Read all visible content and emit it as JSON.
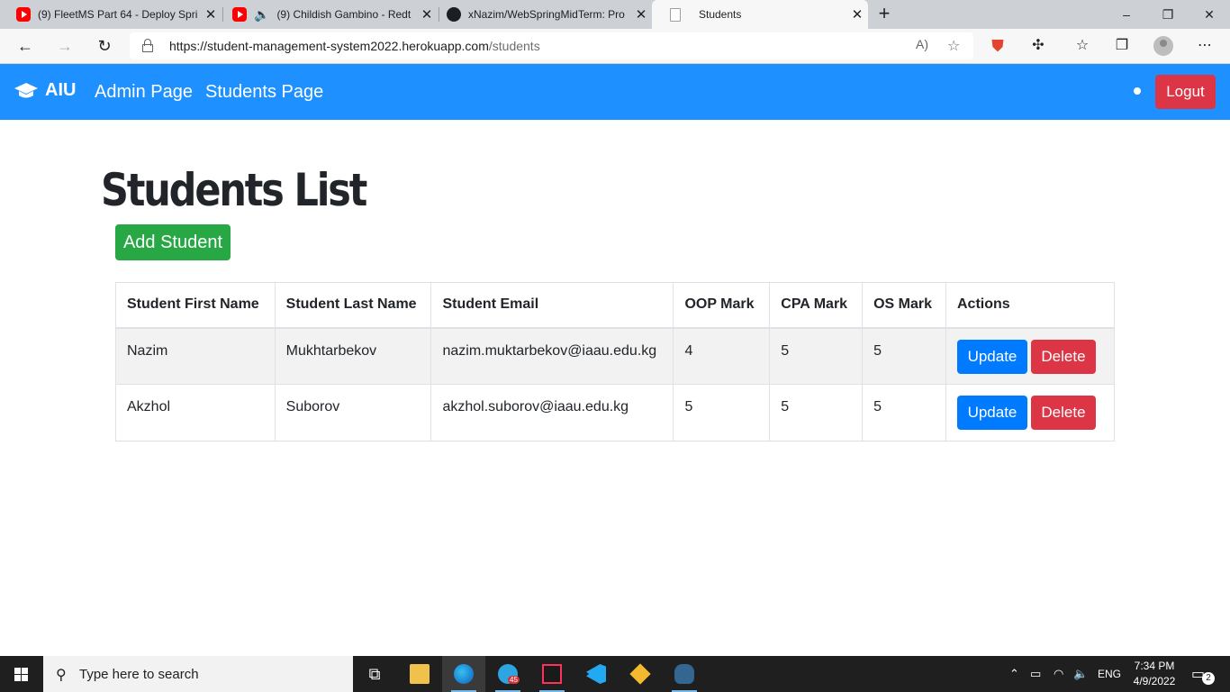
{
  "browser": {
    "tabs": [
      {
        "title": "(9) FleetMS Part 64 - Deploy Spri",
        "icon": "youtube-icon"
      },
      {
        "title": "(9) Childish Gambino - Redt",
        "icon": "youtube-icon",
        "audio": "speaker-icon"
      },
      {
        "title": "xNazim/WebSpringMidTerm: Pro",
        "icon": "github-icon"
      },
      {
        "title": "Students",
        "icon": "page-icon",
        "active": true
      }
    ],
    "new_tab_label": "+",
    "window_controls": [
      "–",
      "❐",
      "✕"
    ],
    "address": {
      "host": "https://student-management-system2022.herokuapp.com",
      "path": "/students"
    }
  },
  "navbar": {
    "brand": "AIU",
    "brand_icon": "graduation-cap-icon",
    "links": [
      "Admin Page",
      "Students Page"
    ],
    "logout_label": "Logut",
    "color": "#1e90ff"
  },
  "main": {
    "title": "Students List",
    "add_button_label": "Add Student",
    "table": {
      "headers": [
        "Student First Name",
        "Student Last Name",
        "Student Email",
        "OOP Mark",
        "CPA Mark",
        "OS Mark",
        "Actions"
      ],
      "rows": [
        {
          "first": "Nazim",
          "last": "Mukhtarbekov",
          "email": "nazim.muktarbekov@iaau.edu.kg",
          "oop": "4",
          "cpa": "5",
          "os": "5"
        },
        {
          "first": "Akzhol",
          "last": "Suborov",
          "email": "akzhol.suborov@iaau.edu.kg",
          "oop": "5",
          "cpa": "5",
          "os": "5"
        }
      ],
      "update_label": "Update",
      "delete_label": "Delete"
    }
  },
  "taskbar": {
    "search_placeholder": "Type here to search",
    "telegram_badge": "45",
    "language": "ENG",
    "time": "7:34 PM",
    "date": "4/9/2022",
    "notification_count": "2"
  }
}
